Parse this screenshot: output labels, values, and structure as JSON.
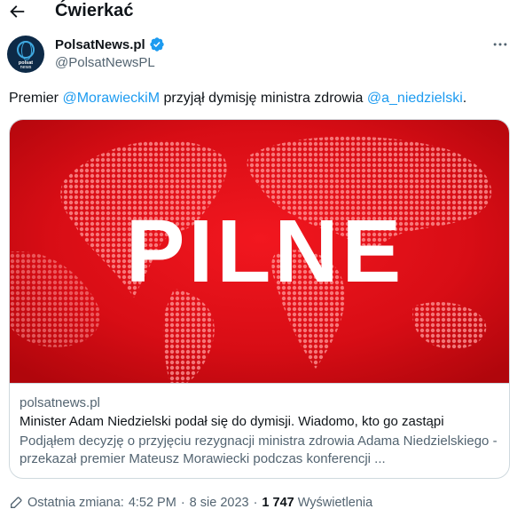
{
  "header": {
    "title": "Ćwierkać",
    "back_icon": "arrow-left-icon"
  },
  "author": {
    "display_name": "PolsatNews.pl",
    "handle": "@PolsatNewsPL",
    "avatar_line1": "polsat",
    "avatar_line2": "news",
    "verified_icon": "verified-badge-icon",
    "more_icon": "more-horizontal-icon"
  },
  "tweet": {
    "text_before": "Premier ",
    "mention1": "@MorawieckiM",
    "text_middle": " przyjął dymisję ministra zdrowia ",
    "mention2": "@a_niedzielski",
    "text_after": "."
  },
  "card": {
    "image_text": "PILNE",
    "domain": "polsatnews.pl",
    "title": "Minister Adam Niedzielski podał się do dymisji. Wiadomo, kto go zastąpi",
    "description": "Podjąłem decyzję o przyjęciu rezygnacji ministra zdrowia Adama Niedzielskiego - przekazał premier Mateusz Morawiecki podczas konferencji ..."
  },
  "meta": {
    "edit_icon": "pencil-edit-icon",
    "edited_label": "Ostatnia zmiana:",
    "time": "4:52 PM",
    "separator": "·",
    "date": "8 sie 2023",
    "views_count": "1 747",
    "views_label": "Wyświetlenia"
  },
  "colors": {
    "accent": "#1d9bf0",
    "text_primary": "#0f1419",
    "text_secondary": "#536471",
    "border": "#cfd9de",
    "card_red": "#e3101a"
  }
}
